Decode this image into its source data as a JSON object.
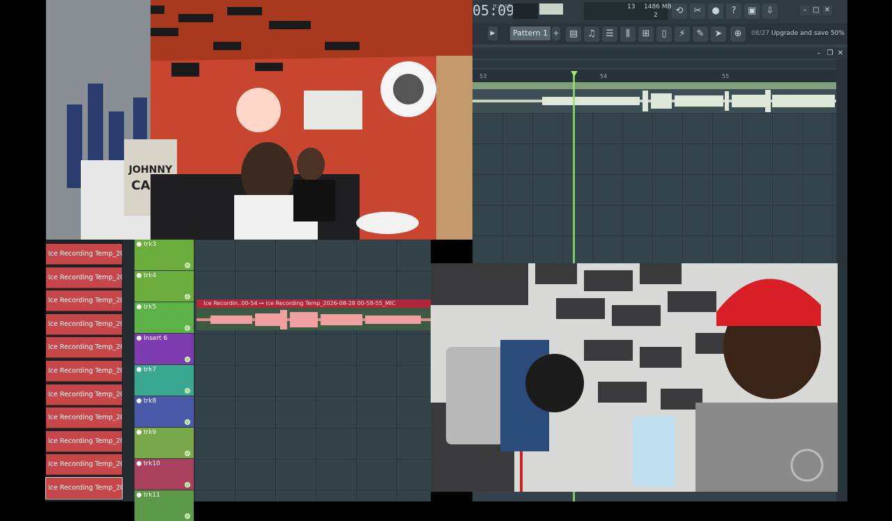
{
  "transport": {
    "time": "05:09",
    "time_unit": "M:S:CS",
    "cpu_value": "13",
    "memory": "1486 MB",
    "poly": "2"
  },
  "toolbar": {
    "pattern_label": "Pattern 1",
    "date": "08/27",
    "upgrade_text": "Upgrade and save 50%",
    "icons": [
      "undo-icon",
      "cut-icon",
      "mic-icon",
      "help-icon",
      "save-icon",
      "render-icon",
      "playlist-icon",
      "piano-roll-icon",
      "channel-rack-icon",
      "mixer-icon",
      "browser-icon",
      "plugin-icon",
      "plug-icon",
      "brush-icon",
      "arrow-icon",
      "cart-icon"
    ]
  },
  "playlist": {
    "bar_numbers": [
      "53",
      "54",
      "55"
    ]
  },
  "channels": {
    "items": [
      "Ice Recording Temp_202...",
      "Ice Recording Temp_202...",
      "Ice Recording Temp_202...",
      "Ice Recording Temp_202...",
      "Ice Recording Temp_202...",
      "Ice Recording Temp_202...",
      "Ice Recording Temp_202...",
      "Ice Recording Temp_202...",
      "Ice Recording Temp_202...",
      "Ice Recording Temp_202...",
      "Ice Recording Temp_202..."
    ]
  },
  "tracks": [
    {
      "name": "trk3",
      "color": "#6aad3c"
    },
    {
      "name": "trk4",
      "color": "#6aad3c"
    },
    {
      "name": "trk5",
      "color": "#5bb347"
    },
    {
      "name": "Insert 6",
      "color": "#7e3cb0"
    },
    {
      "name": "trk7",
      "color": "#3aa890"
    },
    {
      "name": "trk8",
      "color": "#4a5aa8"
    },
    {
      "name": "trk9",
      "color": "#79a84a"
    },
    {
      "name": "trk10",
      "color": "#a8405e"
    },
    {
      "name": "trk11",
      "color": "#5a9a48"
    }
  ],
  "clip": {
    "label": "Ice Recordin..00-54 ↦ Ice Recording Temp_2026-08-28 00-58-55_MIC"
  },
  "colors": {
    "channel_red": "#c6464a",
    "playhead_green": "#8fe36b",
    "waveform_pink": "#e38b8b"
  }
}
